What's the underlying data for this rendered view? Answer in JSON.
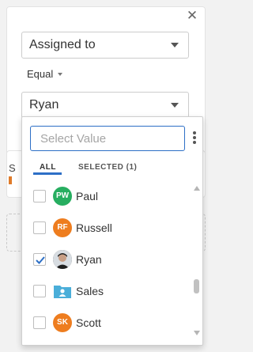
{
  "filter": {
    "field": {
      "value": "Assigned to"
    },
    "operator": {
      "value": "Equal"
    },
    "value_select": {
      "value": "Ryan"
    }
  },
  "background": {
    "partial_text": "S"
  },
  "dropdown": {
    "search": {
      "placeholder": "Select Value"
    },
    "tabs": {
      "all": "ALL",
      "selected": "SELECTED (1)"
    },
    "items": [
      {
        "initials": "PW",
        "name": "Paul",
        "checked": false,
        "avatar_color": "#27ae60",
        "kind": "initials"
      },
      {
        "initials": "RF",
        "name": "Russell",
        "checked": false,
        "avatar_color": "#ee7d1f",
        "kind": "initials"
      },
      {
        "initials": "",
        "name": "Ryan",
        "checked": true,
        "avatar_color": "#3a3a3a",
        "kind": "photo"
      },
      {
        "initials": "",
        "name": "Sales",
        "checked": false,
        "avatar_color": "#4aaed9",
        "kind": "group"
      },
      {
        "initials": "SK",
        "name": "Scott",
        "checked": false,
        "avatar_color": "#ee7d1f",
        "kind": "initials"
      }
    ]
  },
  "colors": {
    "accent": "#2d6fc6"
  }
}
